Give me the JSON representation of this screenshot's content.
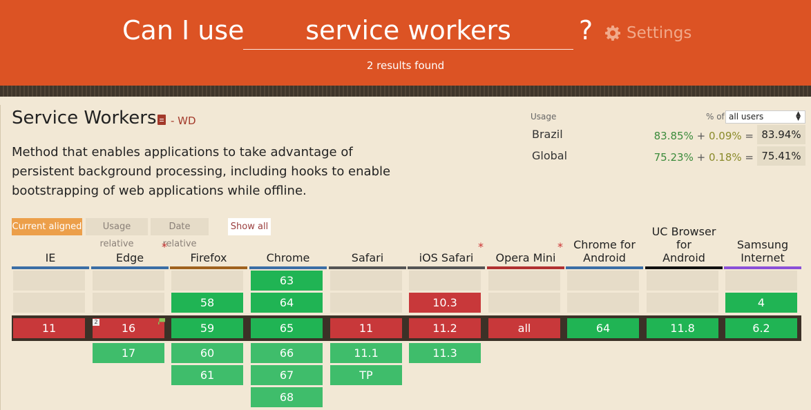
{
  "header": {
    "brand": "Can I use",
    "search_value": "service workers",
    "question_mark": "?",
    "settings_label": "Settings",
    "results": "2 results found"
  },
  "feature": {
    "title": "Service Workers",
    "spec_status": "- WD",
    "description": "Method that enables applications to take advantage of persistent background processing, including hooks to enable bootstrapping of web applications while offline."
  },
  "usage": {
    "label": "Usage",
    "percent_of": "% of",
    "users_select": "all users",
    "rows": [
      {
        "region": "Brazil",
        "full": "83.85%",
        "plus": "+",
        "partial": "0.09%",
        "equals": "=",
        "total": "83.94%"
      },
      {
        "region": "Global",
        "full": "75.23%",
        "plus": "+",
        "partial": "0.18%",
        "equals": "=",
        "total": "75.41%"
      }
    ]
  },
  "view_buttons": {
    "current": "Current aligned",
    "relative": "Usage relative",
    "date": "Date relative",
    "show_all": "Show all"
  },
  "colors": {
    "header": "#dc5324",
    "supported": "#20b454",
    "not_supported": "#c8383a",
    "future_supported": "#3fbd6b",
    "empty": "#e6dcc8"
  },
  "browsers": [
    {
      "name": "IE",
      "bar": "#3b6ea5",
      "star": false,
      "pre2": "",
      "pre1": "",
      "current": "11",
      "cur_status": "n",
      "post1": "",
      "post2": "",
      "post3": ""
    },
    {
      "name": "Edge",
      "bar": "#3b6ea5",
      "star": true,
      "pre2": "",
      "pre1": "",
      "current": "16",
      "cur_status": "n",
      "post1": "17",
      "post2": "",
      "post3": ""
    },
    {
      "name": "Firefox",
      "bar": "#a0621e",
      "star": false,
      "pre2": "",
      "pre1": "58",
      "pre1_status": "y",
      "current": "59",
      "cur_status": "y",
      "post1": "60",
      "post2": "61",
      "post3": ""
    },
    {
      "name": "Chrome",
      "bar": "#3b6ea5",
      "star": false,
      "pre2": "63",
      "pre1": "64",
      "pre1_status": "y",
      "current": "65",
      "cur_status": "y",
      "post1": "66",
      "post2": "67",
      "post3": "68"
    },
    {
      "name": "Safari",
      "bar": "#555555",
      "star": false,
      "pre2": "",
      "pre1": "",
      "current": "11",
      "cur_status": "n",
      "post1": "11.1",
      "post2": "TP",
      "post3": ""
    },
    {
      "name": "iOS Safari",
      "bar": "#555555",
      "star": true,
      "pre2": "",
      "pre1": "10.3",
      "pre1_status": "n",
      "current": "11.2",
      "cur_status": "n",
      "post1": "11.3",
      "post2": "",
      "post3": ""
    },
    {
      "name": "Opera Mini",
      "bar": "#b03030",
      "star": true,
      "pre2": "",
      "pre1": "",
      "current": "all",
      "cur_status": "n",
      "post1": "",
      "post2": "",
      "post3": ""
    },
    {
      "name": "Chrome for Android",
      "bar": "#3b6ea5",
      "star": false,
      "pre2": "",
      "pre1": "",
      "current": "64",
      "cur_status": "y",
      "post1": "",
      "post2": "",
      "post3": ""
    },
    {
      "name": "UC Browser for Android",
      "bar": "#111111",
      "star": false,
      "pre2": "",
      "pre1": "",
      "current": "11.8",
      "cur_status": "y",
      "post1": "",
      "post2": "",
      "post3": ""
    },
    {
      "name": "Samsung Internet",
      "bar": "#8a4fd8",
      "star": false,
      "pre2": "",
      "pre1": "4",
      "pre1_status": "y",
      "current": "6.2",
      "cur_status": "y",
      "post1": "",
      "post2": "",
      "post3": ""
    }
  ],
  "edge_note_number": "2"
}
